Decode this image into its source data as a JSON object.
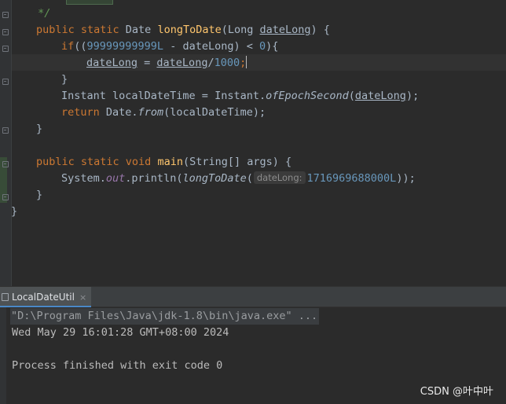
{
  "editor": {
    "comment_close": " */",
    "lines": {
      "l1": {
        "kw": "public static",
        "type": " Date ",
        "fn": "longToDate",
        "p1": "(Long ",
        "param": "dateLong",
        "p2": ") {"
      },
      "l2": {
        "kw": "if",
        "p1": "((",
        "num": "99999999999L",
        "p2": " - dateLong) < ",
        "num2": "0",
        "p3": "){"
      },
      "l3": {
        "var": "dateLong",
        "p1": " = ",
        "var2": "dateLong",
        "p2": "/",
        "num": "1000",
        "p3": ";"
      },
      "l4": {
        "text": "}"
      },
      "l5": {
        "p1": "Instant localDateTime = Instant.",
        "method": "ofEpochSecond",
        "p2": "(",
        "var": "dateLong",
        "p3": ");"
      },
      "l6": {
        "kw": "return",
        "p1": " Date.",
        "method": "from",
        "p2": "(localDateTime);"
      },
      "l7": {
        "text": "}"
      },
      "l8": {
        "kw": "public static void",
        "fn": "main",
        "p1": "(String[] args) {"
      },
      "l9": {
        "p1": "System.",
        "field": "out",
        "p2": ".println(",
        "method": "longToDate",
        "p3": "(",
        "hint": "dateLong:",
        "num": "1716969688000L",
        "p4": "));"
      },
      "l10": {
        "text": "}"
      },
      "l11": {
        "text": "}"
      }
    }
  },
  "console": {
    "tab_label": "LocalDateUtil",
    "tab_close": "×",
    "command": "\"D:\\Program Files\\Java\\jdk-1.8\\bin\\java.exe\" ...",
    "output": "Wed May 29 16:01:28 GMT+08:00 2024",
    "exit_message": "Process finished with exit code 0"
  },
  "watermark": "CSDN @叶中叶",
  "colors": {
    "keyword": "#cc7832",
    "function": "#ffc66d",
    "number": "#6897bb",
    "comment": "#629755",
    "text": "#a9b7c6",
    "background": "#2b2b2b"
  },
  "icons": {
    "tab": "console-icon",
    "fold": "fold-marker-icon"
  }
}
